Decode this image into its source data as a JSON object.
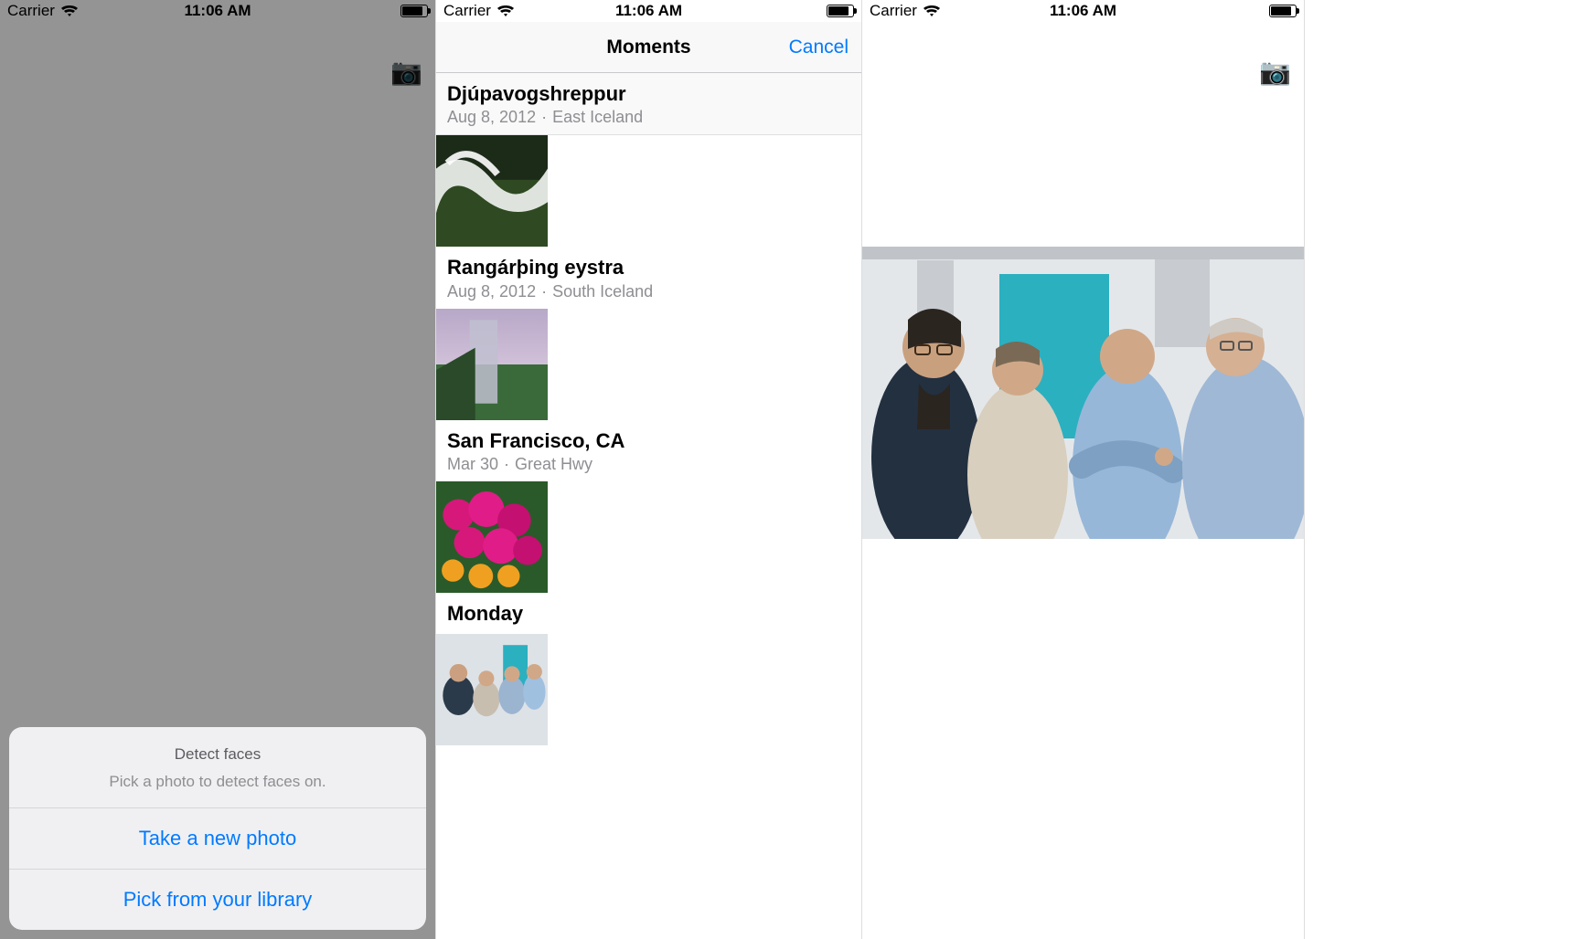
{
  "status": {
    "carrier": "Carrier",
    "time": "11:06 AM"
  },
  "phone1": {
    "camera_glyph": "📷",
    "sheet": {
      "title": "Detect faces",
      "subtitle": "Pick a photo to detect faces on.",
      "option_camera": "Take a new photo",
      "option_library": "Pick from your library"
    }
  },
  "phone2": {
    "nav_title": "Moments",
    "nav_cancel": "Cancel",
    "moments": [
      {
        "title": "Djúpavogshreppur",
        "date": "Aug 8, 2012",
        "place": "East Iceland"
      },
      {
        "title": "Rangárþing eystra",
        "date": "Aug 8, 2012",
        "place": "South Iceland"
      },
      {
        "title": "San Francisco, CA",
        "date": "Mar 30",
        "place": "Great Hwy"
      },
      {
        "title": "Monday",
        "date": "",
        "place": ""
      }
    ]
  },
  "phone3": {
    "camera_glyph": "📷"
  }
}
